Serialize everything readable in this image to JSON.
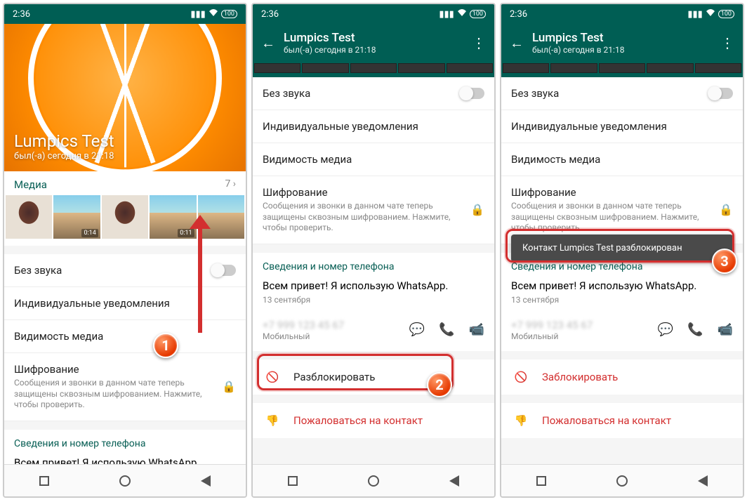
{
  "status": {
    "time": "2:36",
    "signal_icon": "signal-icon",
    "wifi_icon": "wifi-icon",
    "battery_text": "100"
  },
  "header": {
    "title": "Lumpics Test",
    "subtitle": "был(-а) сегодня в 21:18"
  },
  "screen1": {
    "hero_title": "Lumpics Test",
    "hero_subtitle": "был(-а) сегодня в 21:18",
    "media_label": "Медиа",
    "media_count": "7 ›",
    "tiles_dur": [
      "",
      "0:14",
      "",
      "0:11",
      ""
    ],
    "mute_label": "Без звука",
    "custom_notif_label": "Индивидуальные уведомления",
    "media_vis_label": "Видимость медиа",
    "encryption_label": "Шифрование",
    "encryption_sub": "Сообщения и звонки в данном чате теперь защищены сквозным шифрованием. Нажмите, чтобы проверить.",
    "info_section": "Сведения и номер телефона",
    "status_text": "Всем привет! Я использую WhatsApp."
  },
  "screen2": {
    "mute_label": "Без звука",
    "custom_notif_label": "Индивидуальные уведомления",
    "media_vis_label": "Видимость медиа",
    "encryption_label": "Шифрование",
    "encryption_sub": "Сообщения и звонки в данном чате теперь защищены сквозным шифрованием. Нажмите, чтобы проверить.",
    "info_section": "Сведения и номер телефона",
    "status_text": "Всем привет! Я использую WhatsApp.",
    "status_date": "13 сентября",
    "phone_type": "Мобильный",
    "unblock_label": "Разблокировать",
    "report_label": "Пожаловаться на контакт"
  },
  "screen3": {
    "mute_label": "Без звука",
    "custom_notif_label": "Индивидуальные уведомления",
    "media_vis_label": "Видимость медиа",
    "encryption_label": "Шифрование",
    "encryption_sub": "Сообщения и звонки в данном чате теперь защищены сквозным шифрованием. Нажмите, чтобы проверить.",
    "toast_text": "Контакт Lumpics Test разблокирован",
    "info_section": "Сведения и номер телефона",
    "status_text": "Всем привет! Я использую WhatsApp.",
    "status_date": "13 сентября",
    "phone_type": "Мобильный",
    "block_label": "Заблокировать",
    "report_label": "Пожаловаться на контакт"
  },
  "badges": {
    "b1": "1",
    "b2": "2",
    "b3": "3"
  }
}
